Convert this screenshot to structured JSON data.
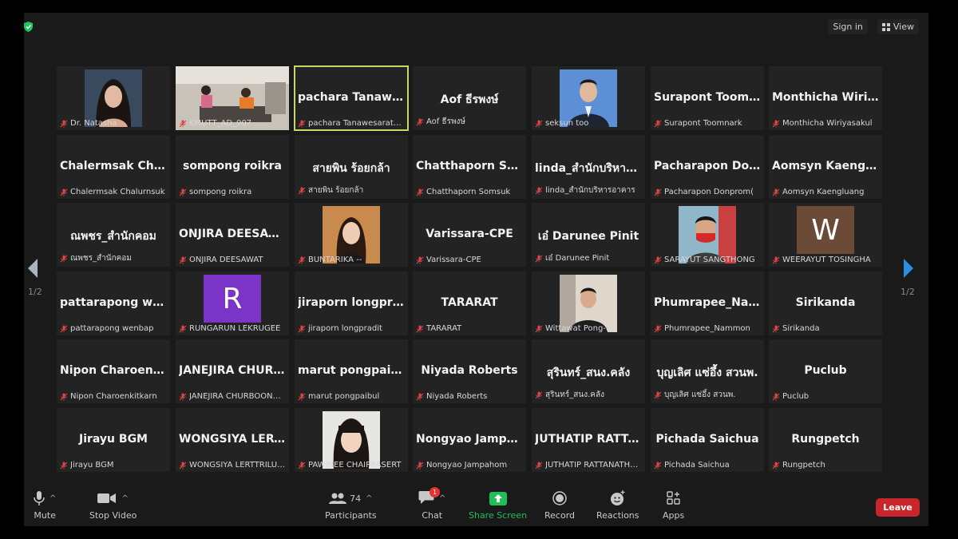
{
  "topbar": {
    "sign_in": "Sign in",
    "view": "View"
  },
  "pager": {
    "left": "1/2",
    "right": "1/2"
  },
  "tiles": [
    {
      "big": "",
      "small": "Dr. Natasha",
      "video": "woman"
    },
    {
      "big": "",
      "small": "KMUTT_AD_907",
      "video": "room"
    },
    {
      "big": "pachara  Tanawesaratchai",
      "small": "pachara Tanawesaratchai",
      "active": true
    },
    {
      "big": "Aof ธีรพงษ์",
      "small": "Aof ธีรพงษ์"
    },
    {
      "big": "",
      "small": "seksun too",
      "video": "man"
    },
    {
      "big": "Surapont  Toomnark",
      "small": "Surapont Toomnark"
    },
    {
      "big": "Monthicha  Wiriyasakul",
      "small": "Monthicha Wiriyasakul"
    },
    {
      "big": "Chalermsak  Chalurnsuk",
      "small": "Chalermsak Chalurnsuk"
    },
    {
      "big": "sompong roikra",
      "small": "sompong roikra"
    },
    {
      "big": "สายพิน  ร้อยกล้า",
      "small": "สายพิน  ร้อยกล้า"
    },
    {
      "big": "Chatthaporn  Somsuk",
      "small": "Chatthaporn Somsuk"
    },
    {
      "big": "linda_สำนักบริหารอาคาร",
      "small": "linda_สำนักบริหารอาคาร"
    },
    {
      "big": "Pacharapon  Donprom",
      "small": "Pacharapon Donprom("
    },
    {
      "big": "Aomsyn  Kaengluang",
      "small": "Aomsyn Kaengluang"
    },
    {
      "big": "ณพชร_สำนักคอม",
      "small": "ณพชร_สำนักคอม"
    },
    {
      "big": "ONJIRA  DEESAWAT",
      "small": "ONJIRA DEESAWAT"
    },
    {
      "big": "",
      "small": "BUNTARIKA --",
      "video": "woman2"
    },
    {
      "big": "Varissara-CPE",
      "small": "Varissara-CPE"
    },
    {
      "big": "เอ๋ Darunee Pinit",
      "small": "เอ๋ Darunee Pinit"
    },
    {
      "big": "",
      "small": "SARAYUT SANGTHONG",
      "video": "mask"
    },
    {
      "big": "",
      "small": "WEERAYUT TOSINGHA",
      "letter": "W",
      "letter_color": "#6b4a38"
    },
    {
      "big": "pattarapong  wenbap",
      "small": "pattarapong wenbap"
    },
    {
      "big": "",
      "small": "RUNGARUN LEKRUGEE",
      "letter": "R",
      "letter_color": "#7a35c8"
    },
    {
      "big": "jiraporn  longpradit",
      "small": "jiraporn longpradit"
    },
    {
      "big": "TARARAT",
      "small": "TARARAT"
    },
    {
      "big": "",
      "small": "Wittawat Pong-im",
      "video": "man2"
    },
    {
      "big": "Phumrapee_Nammon",
      "small": "Phumrapee_Nammon"
    },
    {
      "big": "Sirikanda",
      "small": "Sirikanda"
    },
    {
      "big": "Nipon  Charoenkitkarn",
      "small": "Nipon Charoenkitkarn"
    },
    {
      "big": "JANEJIRA  CHURBOONDEE",
      "small": "JANEJIRA CHURBOONDEE"
    },
    {
      "big": "marut  pongpaibul",
      "small": "marut pongpaibul"
    },
    {
      "big": "Niyada Roberts",
      "small": "Niyada Roberts"
    },
    {
      "big": "สุรินทร์_สนง.คลัง",
      "small": "สุรินทร์_สนง.คลัง"
    },
    {
      "big": "บุญเลิศ  แซ่อึ้ง  สวนพ.",
      "small": "บุญเลิศ แซ่อึ้ง สวนพ."
    },
    {
      "big": "Puclub",
      "small": "Puclub"
    },
    {
      "big": "Jirayu BGM",
      "small": "Jirayu BGM"
    },
    {
      "big": "WONGSIYA  LERTTRILUCK",
      "small": "WONGSIYA LERTTRILUCK"
    },
    {
      "big": "",
      "small": "PAWINEE CHAIPRASERT",
      "video": "woman3"
    },
    {
      "big": "Nongyao  Jampahom",
      "small": "Nongyao Jampahom"
    },
    {
      "big": "JUTHATIP  RATTANATHAM",
      "small": "JUTHATIP RATTANATHAM"
    },
    {
      "big": "Pichada Saichua",
      "small": "Pichada Saichua"
    },
    {
      "big": "Rungpetch",
      "small": "Rungpetch"
    }
  ],
  "toolbar": {
    "mute": "Mute",
    "stop_video": "Stop Video",
    "participants": "Participants",
    "participants_count": "74",
    "chat": "Chat",
    "chat_badge": "1",
    "share_screen": "Share Screen",
    "record": "Record",
    "reactions": "Reactions",
    "apps": "Apps",
    "leave": "Leave"
  },
  "colors": {
    "active_border": "#c4d86a",
    "share_green": "#1fbf5a",
    "leave_red": "#c9262b"
  }
}
